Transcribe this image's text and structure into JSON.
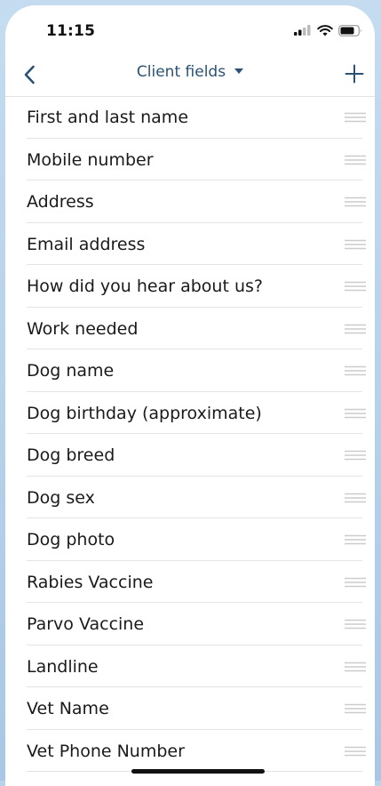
{
  "status_bar": {
    "time": "11:15"
  },
  "nav": {
    "title": "Client fields",
    "back_icon": "chevron-left-icon",
    "add_icon": "plus-icon",
    "accent_color": "#2b5274"
  },
  "fields": [
    {
      "label": "First and last name"
    },
    {
      "label": "Mobile number"
    },
    {
      "label": "Address"
    },
    {
      "label": "Email address"
    },
    {
      "label": "How did you hear about us?"
    },
    {
      "label": "Work needed"
    },
    {
      "label": "Dog name"
    },
    {
      "label": "Dog birthday (approximate)"
    },
    {
      "label": "Dog breed"
    },
    {
      "label": "Dog sex"
    },
    {
      "label": "Dog photo"
    },
    {
      "label": "Rabies Vaccine"
    },
    {
      "label": "Parvo Vaccine"
    },
    {
      "label": "Landline"
    },
    {
      "label": "Vet Name"
    },
    {
      "label": "Vet Phone Number"
    }
  ]
}
